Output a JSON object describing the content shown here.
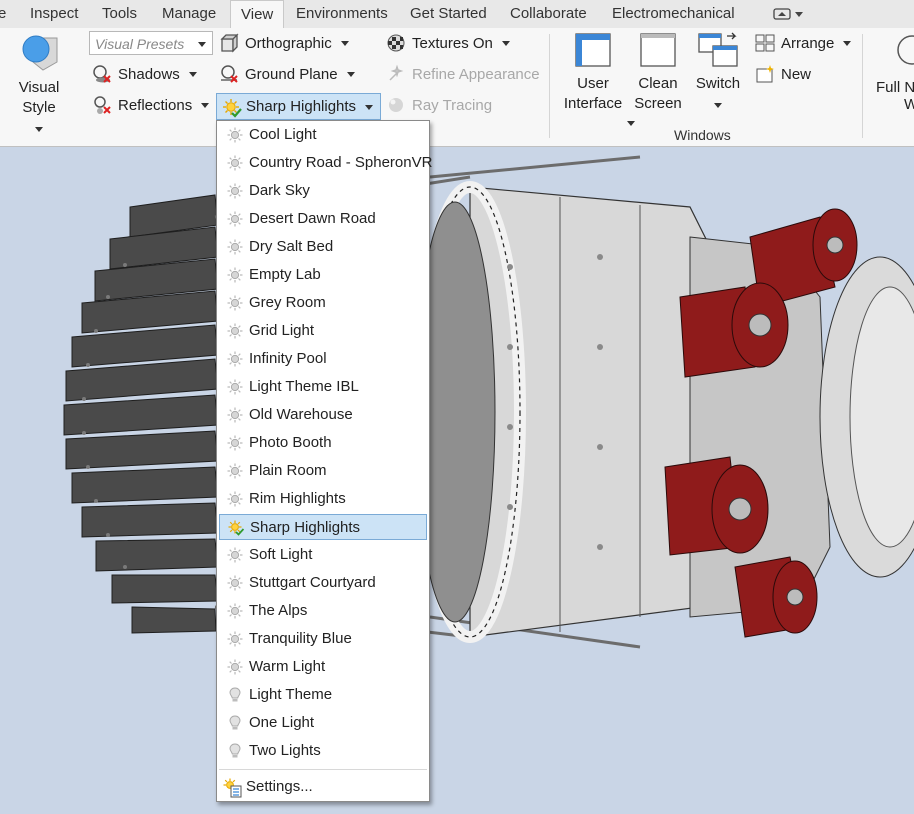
{
  "tabs": [
    {
      "label": "e"
    },
    {
      "label": "Inspect"
    },
    {
      "label": "Tools"
    },
    {
      "label": "Manage"
    },
    {
      "label": "View"
    },
    {
      "label": "Environments"
    },
    {
      "label": "Get Started"
    },
    {
      "label": "Collaborate"
    },
    {
      "label": "Electromechanical"
    }
  ],
  "ribbon": {
    "visual_style_label": "Visual Style",
    "visual_presets_placeholder": "Visual Presets",
    "shadows_label": "Shadows",
    "reflections_label": "Reflections",
    "orthographic_label": "Orthographic",
    "ground_plane_label": "Ground Plane",
    "sharp_highlights_label": "Sharp Highlights",
    "textures_label": "Textures On",
    "refine_label": "Refine Appearance",
    "ray_tracing_label": "Ray Tracing",
    "user_interface_label_1": "User",
    "user_interface_label_2": "Interface",
    "clean_screen_label_1": "Clean",
    "clean_screen_label_2": "Screen",
    "switch_label": "Switch",
    "arrange_label": "Arrange",
    "new_label": "New",
    "windows_group_label": "Windows",
    "full_nav_label_1": "Full N",
    "full_nav_label_2": "W"
  },
  "menu": {
    "items": [
      {
        "label": "Cool Light",
        "icon": "sun"
      },
      {
        "label": "Country Road - SpheronVR",
        "icon": "sun"
      },
      {
        "label": "Dark Sky",
        "icon": "sun"
      },
      {
        "label": "Desert Dawn Road",
        "icon": "sun"
      },
      {
        "label": "Dry Salt Bed",
        "icon": "sun"
      },
      {
        "label": "Empty Lab",
        "icon": "sun"
      },
      {
        "label": "Grey Room",
        "icon": "sun"
      },
      {
        "label": "Grid Light",
        "icon": "sun"
      },
      {
        "label": "Infinity Pool",
        "icon": "sun"
      },
      {
        "label": "Light Theme IBL",
        "icon": "sun"
      },
      {
        "label": "Old Warehouse",
        "icon": "sun"
      },
      {
        "label": "Photo Booth",
        "icon": "sun"
      },
      {
        "label": "Plain Room",
        "icon": "sun"
      },
      {
        "label": "Rim Highlights",
        "icon": "sun"
      },
      {
        "label": "Sharp Highlights",
        "icon": "sun-check",
        "selected": true
      },
      {
        "label": "Soft Light",
        "icon": "sun"
      },
      {
        "label": "Stuttgart Courtyard",
        "icon": "sun"
      },
      {
        "label": "The Alps",
        "icon": "sun"
      },
      {
        "label": "Tranquility Blue",
        "icon": "sun"
      },
      {
        "label": "Warm Light",
        "icon": "sun"
      },
      {
        "label": "Light Theme",
        "icon": "bulb"
      },
      {
        "label": "One Light",
        "icon": "bulb"
      },
      {
        "label": "Two Lights",
        "icon": "bulb"
      }
    ],
    "settings_label": "Settings..."
  },
  "colors": {
    "accent_selection": "#cce3f6",
    "accent_border": "#7aaad6",
    "viewport_bg": "#c9d5e6",
    "flange_red": "#8f1b1b"
  }
}
